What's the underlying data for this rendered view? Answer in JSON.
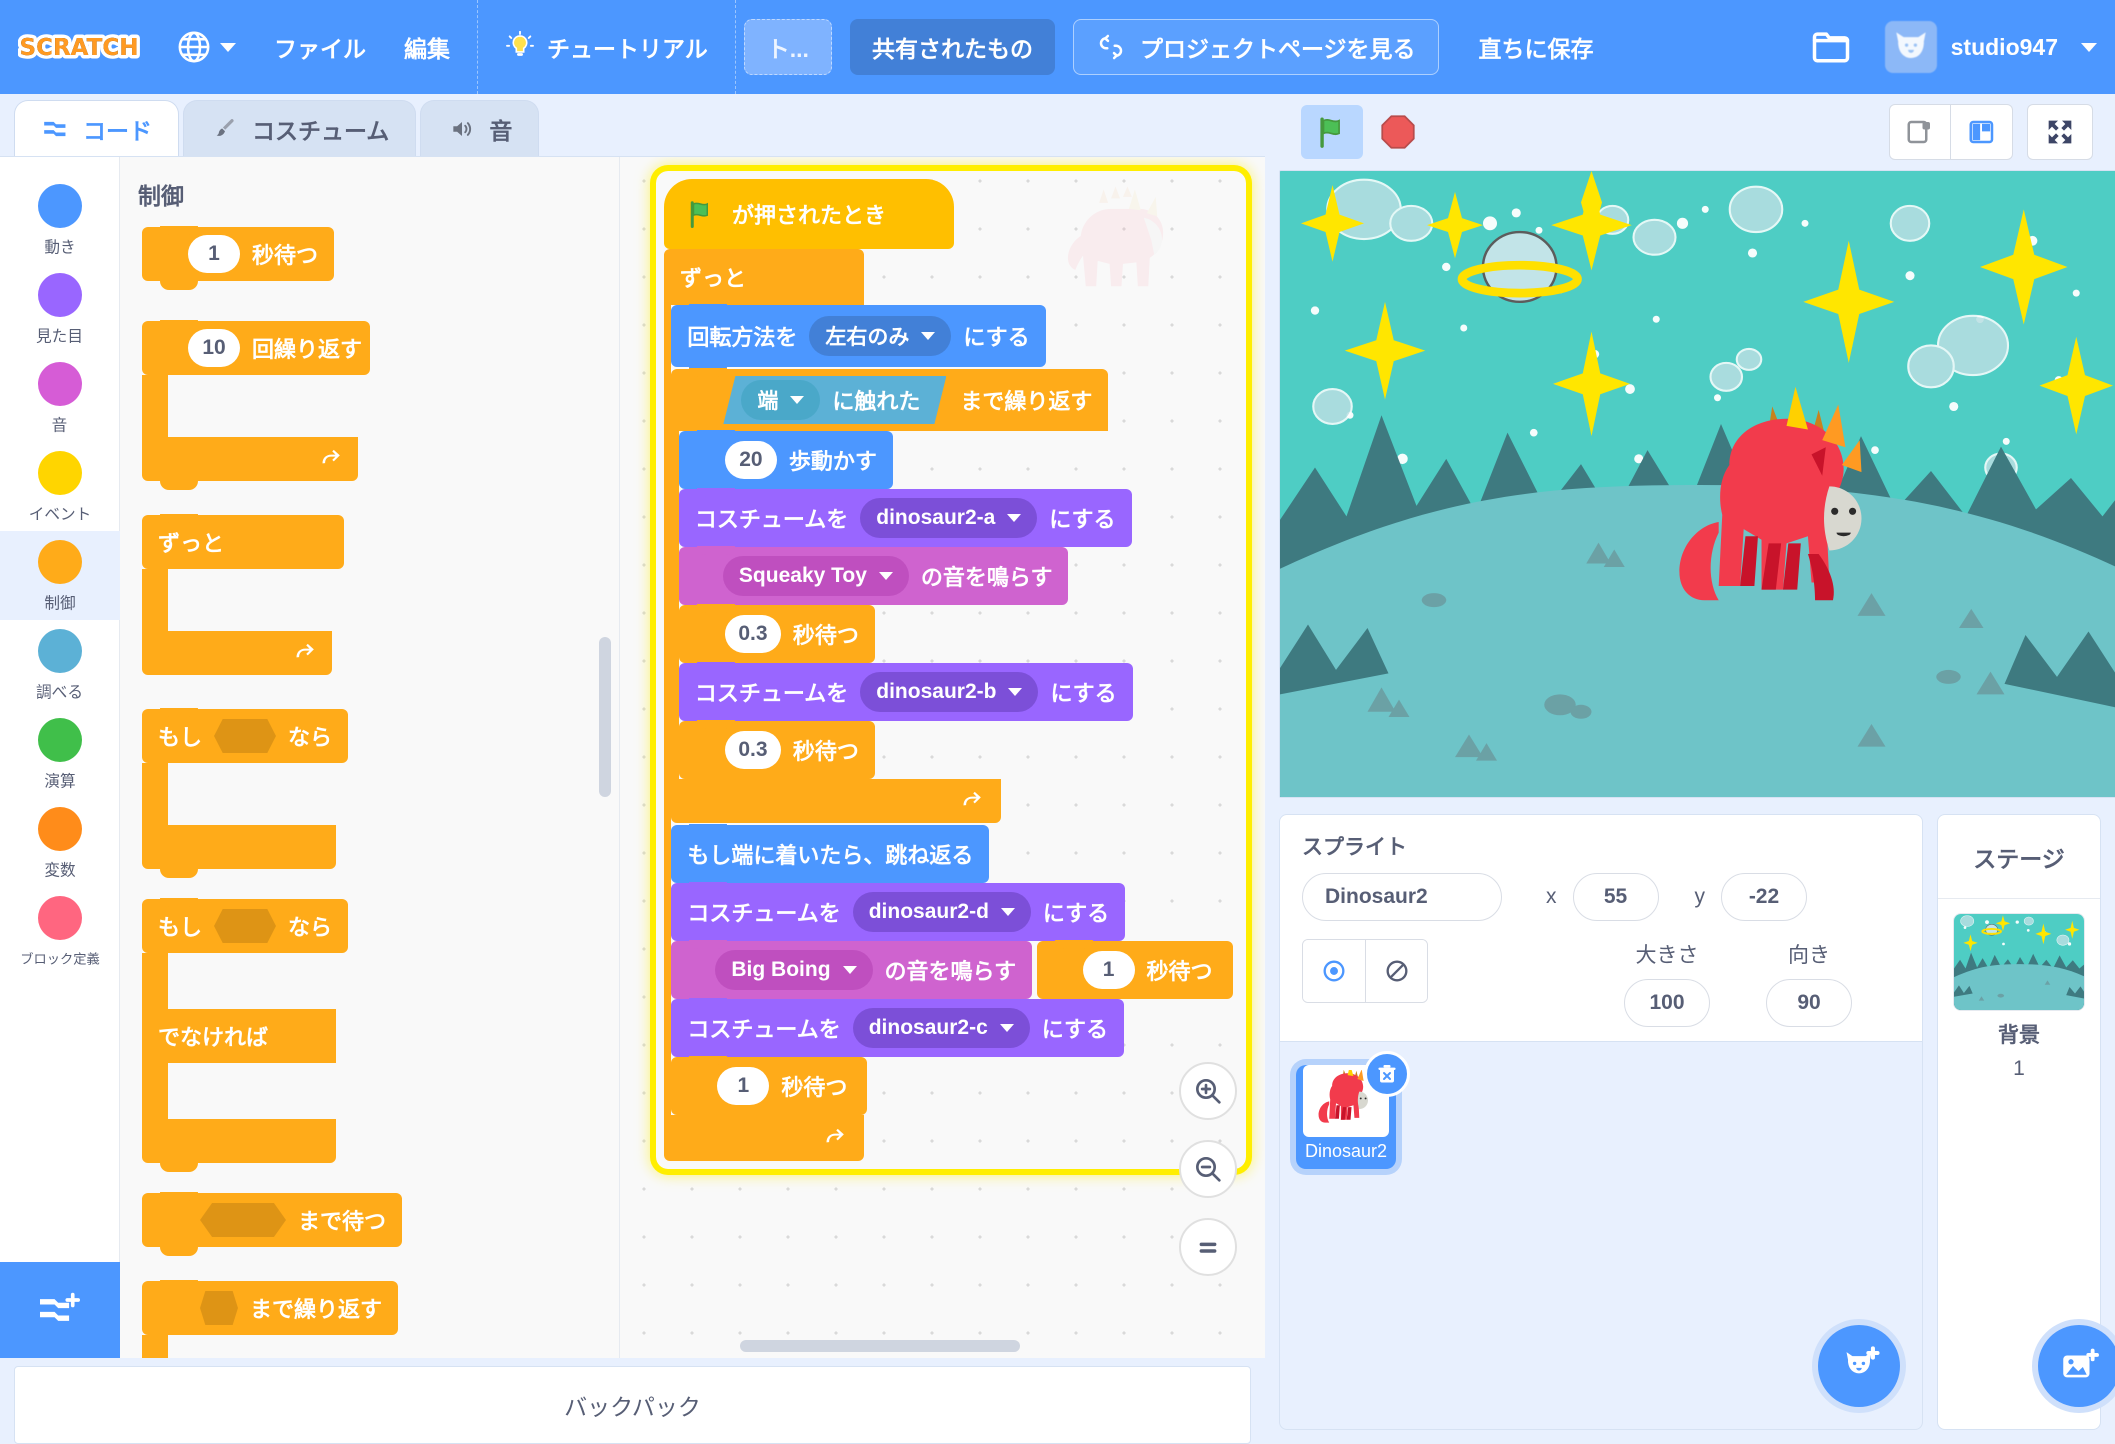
{
  "menu": {
    "logo": "SCRATCH",
    "globe_icon": "globe-icon",
    "file": "ファイル",
    "edit": "編集",
    "tutorials": "チュートリアル",
    "project_title": "ト...",
    "shared": "共有されたもの",
    "see_project_page": "プロジェクトページを見る",
    "save_now": "直ちに保存",
    "folder_icon": "folder-icon",
    "username": "studio947"
  },
  "tabs": [
    {
      "label": "コード",
      "icon": "code-icon",
      "active": true
    },
    {
      "label": "コスチューム",
      "icon": "paintbrush-icon",
      "active": false
    },
    {
      "label": "音",
      "icon": "speaker-icon",
      "active": false
    }
  ],
  "categories": [
    {
      "label": "動き",
      "color": "#4c97ff",
      "selected": false
    },
    {
      "label": "見た目",
      "color": "#9966ff",
      "selected": false
    },
    {
      "label": "音",
      "color": "#cf63cf",
      "selected": false
    },
    {
      "label": "イベント",
      "color": "#ffd500",
      "selected": false
    },
    {
      "label": "制御",
      "color": "#ffab19",
      "selected": true
    },
    {
      "label": "調べる",
      "color": "#5cb1d6",
      "selected": false
    },
    {
      "label": "演算",
      "color": "#40bf4a",
      "selected": false
    },
    {
      "label": "変数",
      "color": "#ff8c1a",
      "selected": false
    },
    {
      "label": "ブロック定義",
      "color": "#ff6680",
      "selected": false
    }
  ],
  "palette": {
    "heading": "制御",
    "blocks": {
      "wait_value": "1",
      "wait_label": "秒待つ",
      "repeat_value": "10",
      "repeat_label": "回繰り返す",
      "forever_label": "ずっと",
      "if_label_a": "もし",
      "if_label_b": "なら",
      "else_label": "でなければ",
      "wait_until_label": "まで待つ",
      "repeat_until_label": "まで繰り返す"
    }
  },
  "script": {
    "hat": {
      "label": "が押されたとき",
      "icon": "green-flag-icon"
    },
    "forever": "ずっと",
    "set_rotation": {
      "prefix": "回転方法を",
      "value": "左右のみ",
      "suffix": "にする"
    },
    "repeat_until": {
      "sensing_value": "端",
      "sensing_suffix": "に触れた",
      "label": "まで繰り返す"
    },
    "move": {
      "value": "20",
      "label": "歩動かす"
    },
    "costume_a": {
      "prefix": "コスチュームを",
      "value": "dinosaur2-a",
      "suffix": "にする"
    },
    "sound_squeaky": {
      "value": "Squeaky Toy",
      "suffix": "の音を鳴らす"
    },
    "wait_03_a": {
      "value": "0.3",
      "label": "秒待つ"
    },
    "costume_b": {
      "prefix": "コスチュームを",
      "value": "dinosaur2-b",
      "suffix": "にする"
    },
    "wait_03_b": {
      "value": "0.3",
      "label": "秒待つ"
    },
    "bounce": "もし端に着いたら、跳ね返る",
    "costume_d": {
      "prefix": "コスチュームを",
      "value": "dinosaur2-d",
      "suffix": "にする"
    },
    "sound_boing": {
      "value": "Big Boing",
      "suffix": "の音を鳴らす"
    },
    "wait_1_a": {
      "value": "1",
      "label": "秒待つ"
    },
    "costume_c": {
      "prefix": "コスチュームを",
      "value": "dinosaur2-c",
      "suffix": "にする"
    },
    "wait_1_b": {
      "value": "1",
      "label": "秒待つ"
    }
  },
  "workspace": {
    "zoom_in_icon": "zoom-in-icon",
    "zoom_out_icon": "zoom-out-icon",
    "zoom_reset_icon": "zoom-reset-icon"
  },
  "backpack": {
    "label": "バックパック"
  },
  "stage_controls": {
    "green_flag_icon": "green-flag-icon",
    "stop_icon": "stop-icon",
    "small_stage_icon": "small-stage-icon",
    "large_stage_icon": "large-stage-icon",
    "fullscreen_icon": "fullscreen-icon"
  },
  "sprite_info": {
    "heading": "スプライト",
    "name": "Dinosaur2",
    "x_label": "x",
    "x_value": "55",
    "y_label": "y",
    "y_value": "-22",
    "size_label": "大きさ",
    "size_value": "100",
    "direction_label": "向き",
    "direction_value": "90",
    "show_icon": "eye-icon",
    "hide_icon": "eye-slash-icon"
  },
  "sprite_list": {
    "items": [
      {
        "name": "Dinosaur2",
        "selected": true
      }
    ],
    "delete_icon": "trash-icon",
    "add_sprite_icon": "add-sprite-icon"
  },
  "stage_pane": {
    "heading": "ステージ",
    "backdrops_label": "背景",
    "backdrops_count": "1",
    "add_backdrop_icon": "add-backdrop-icon"
  },
  "colors": {
    "brand_blue": "#4c97ff",
    "control_orange": "#ffab19",
    "motion_blue": "#4c97ff",
    "looks_purple": "#9966ff",
    "sound_magenta": "#cf63cf",
    "sensing_cyan": "#5cb1d6",
    "glow_yellow": "#ffee00",
    "panel_bg": "#e8f0fe"
  }
}
